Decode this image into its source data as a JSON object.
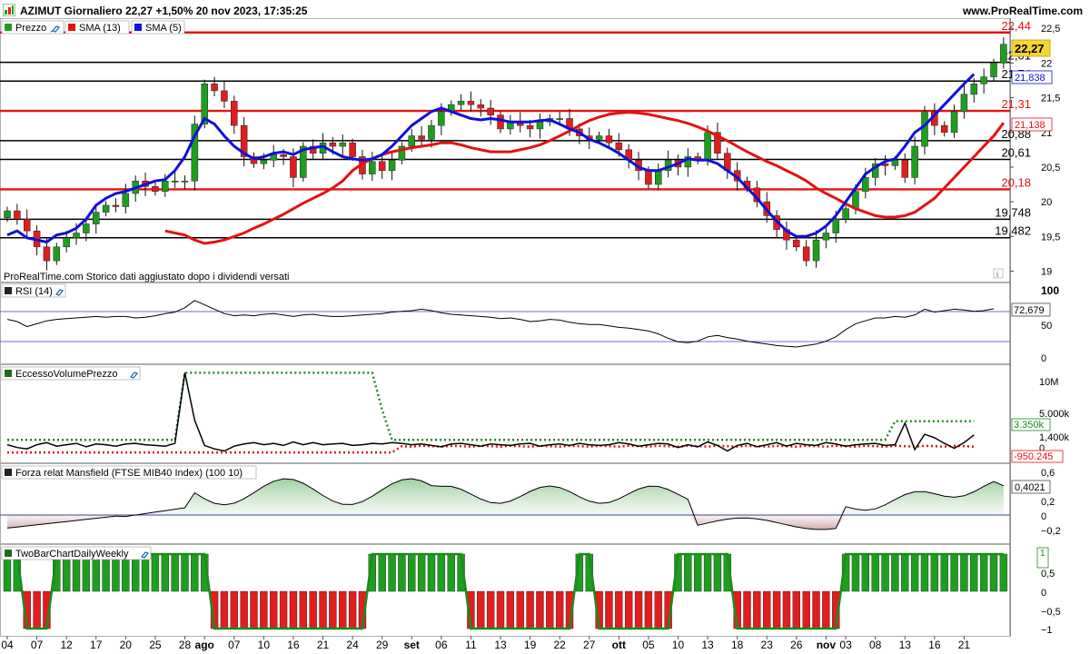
{
  "header": {
    "title": "AZIMUT Giornaliero 22,27 +1,50% 20 nov 2023, 17:35:25",
    "site": "www.ProRealTime.com"
  },
  "colors": {
    "up": "#1e9e1e",
    "down": "#e21d1d",
    "sma13": "#e31212",
    "sma5": "#1010d6",
    "dotted_green": "#1e8a1e",
    "dotted_red": "#e31212"
  },
  "price_panel": {
    "legend": [
      {
        "label": "Prezzo",
        "color": "#1e9e1e"
      },
      {
        "label": "SMA (13)",
        "color": "#e31212"
      },
      {
        "label": "SMA (5)",
        "color": "#1010d6"
      }
    ],
    "note": "ProRealTime.com Storico dati aggiustato dopo i dividendi versati",
    "y_ticks": [
      "22,5",
      "22",
      "21,5",
      "21",
      "20,5",
      "20",
      "19,5",
      "19"
    ],
    "last_price": "22,27",
    "sma5_value": "21,838",
    "sma13_value": "21,138",
    "levels": [
      {
        "value": 22.44,
        "label": "22,44",
        "color": "red"
      },
      {
        "value": 22.01,
        "label": "22,01",
        "color": "black"
      },
      {
        "value": 21.74,
        "label": "21,74",
        "color": "black"
      },
      {
        "value": 21.31,
        "label": "21,31",
        "color": "red"
      },
      {
        "value": 20.88,
        "label": "20,88",
        "color": "black"
      },
      {
        "value": 20.61,
        "label": "20,61",
        "color": "black"
      },
      {
        "value": 20.18,
        "label": "20,18",
        "color": "red"
      },
      {
        "value": 19.748,
        "label": "19,748",
        "color": "black"
      },
      {
        "value": 19.482,
        "label": "19,482",
        "color": "black"
      }
    ]
  },
  "rsi_panel": {
    "title": "RSI (14)",
    "y_ticks": [
      "100",
      "50",
      "0"
    ],
    "value": "72,679"
  },
  "volume_panel": {
    "title": "EccessoVolumePrezzo",
    "y_ticks": [
      "10M",
      "5.000k",
      "1,400k",
      "0"
    ],
    "value_green": "3.350k",
    "value_red": "-950.245"
  },
  "mansfield_panel": {
    "title": "Forza relat Mansfield (FTSE MIB40 Index) (100 10)",
    "y_ticks": [
      "0,6",
      "0,4021",
      "0,2",
      "0",
      "−0,2"
    ],
    "value": "0,4021"
  },
  "twobar_panel": {
    "title": "TwoBarChartDailyWeekly",
    "y_ticks": [
      "1",
      "0,5",
      "0",
      "−0,5",
      "−1"
    ],
    "value": "1"
  },
  "x_axis": {
    "labels": [
      {
        "text": "04",
        "idx": 0,
        "bold": false
      },
      {
        "text": "07",
        "idx": 3,
        "bold": false
      },
      {
        "text": "12",
        "idx": 6,
        "bold": false
      },
      {
        "text": "17",
        "idx": 9,
        "bold": false
      },
      {
        "text": "20",
        "idx": 12,
        "bold": false
      },
      {
        "text": "25",
        "idx": 15,
        "bold": false
      },
      {
        "text": "28",
        "idx": 18,
        "bold": false
      },
      {
        "text": "ago",
        "idx": 20,
        "bold": true
      },
      {
        "text": "07",
        "idx": 23,
        "bold": false
      },
      {
        "text": "10",
        "idx": 26,
        "bold": false
      },
      {
        "text": "16",
        "idx": 29,
        "bold": false
      },
      {
        "text": "21",
        "idx": 32,
        "bold": false
      },
      {
        "text": "24",
        "idx": 35,
        "bold": false
      },
      {
        "text": "29",
        "idx": 38,
        "bold": false
      },
      {
        "text": "set",
        "idx": 41,
        "bold": true
      },
      {
        "text": "06",
        "idx": 44,
        "bold": false
      },
      {
        "text": "11",
        "idx": 47,
        "bold": false
      },
      {
        "text": "13",
        "idx": 50,
        "bold": false
      },
      {
        "text": "19",
        "idx": 53,
        "bold": false
      },
      {
        "text": "22",
        "idx": 56,
        "bold": false
      },
      {
        "text": "27",
        "idx": 59,
        "bold": false
      },
      {
        "text": "ott",
        "idx": 62,
        "bold": true
      },
      {
        "text": "05",
        "idx": 65,
        "bold": false
      },
      {
        "text": "10",
        "idx": 68,
        "bold": false
      },
      {
        "text": "13",
        "idx": 71,
        "bold": false
      },
      {
        "text": "18",
        "idx": 74,
        "bold": false
      },
      {
        "text": "23",
        "idx": 77,
        "bold": false
      },
      {
        "text": "26",
        "idx": 80,
        "bold": false
      },
      {
        "text": "nov",
        "idx": 83,
        "bold": true
      },
      {
        "text": "03",
        "idx": 85,
        "bold": false
      },
      {
        "text": "08",
        "idx": 88,
        "bold": false
      },
      {
        "text": "13",
        "idx": 91,
        "bold": false
      },
      {
        "text": "16",
        "idx": 94,
        "bold": false
      },
      {
        "text": "21",
        "idx": 97,
        "bold": false
      }
    ]
  },
  "chart_data": [
    {
      "type": "candlestick",
      "ylim": [
        18.85,
        22.62
      ],
      "close": [
        19.87,
        19.75,
        19.58,
        19.35,
        19.15,
        19.35,
        19.48,
        19.55,
        19.68,
        19.85,
        19.95,
        19.93,
        20.12,
        20.3,
        20.22,
        20.15,
        20.3,
        20.3,
        20.3,
        21.12,
        21.7,
        21.6,
        21.45,
        21.1,
        20.65,
        20.55,
        20.6,
        20.68,
        20.65,
        20.35,
        20.8,
        20.7,
        20.85,
        20.8,
        20.85,
        20.65,
        20.4,
        20.58,
        20.45,
        20.6,
        20.8,
        20.95,
        20.9,
        21.1,
        21.3,
        21.4,
        21.45,
        21.4,
        21.35,
        21.25,
        21.05,
        21.15,
        21.1,
        21.05,
        21.15,
        21.2,
        21.2,
        21.05,
        20.95,
        20.9,
        20.95,
        20.85,
        20.75,
        20.6,
        20.45,
        20.25,
        20.45,
        20.6,
        20.5,
        20.65,
        20.6,
        21.0,
        20.7,
        20.45,
        20.3,
        20.2,
        20.0,
        19.8,
        19.6,
        19.45,
        19.35,
        19.15,
        19.45,
        19.55,
        19.75,
        19.9,
        20.15,
        20.35,
        20.55,
        20.52,
        20.6,
        20.35,
        20.8,
        21.3,
        21.1,
        21.0,
        21.3,
        21.55,
        21.7,
        21.8,
        22.0,
        22.27
      ],
      "sma5": [
        19.52,
        19.58,
        19.48,
        19.45,
        19.42,
        19.52,
        19.55,
        19.62,
        19.75,
        19.95,
        20.05,
        20.12,
        20.15,
        20.2,
        20.25,
        20.3,
        20.32,
        20.45,
        20.65,
        20.95,
        21.2,
        21.12,
        20.95,
        20.8,
        20.7,
        20.62,
        20.65,
        20.7,
        20.72,
        20.68,
        20.75,
        20.78,
        20.8,
        20.72,
        20.65,
        20.62,
        20.6,
        20.62,
        20.68,
        20.8,
        20.95,
        21.1,
        21.2,
        21.3,
        21.35,
        21.3,
        21.25,
        21.2,
        21.18,
        21.2,
        21.18,
        21.15,
        21.15,
        21.15,
        21.17,
        21.18,
        21.12,
        21.05,
        21.0,
        20.9,
        20.85,
        20.78,
        20.7,
        20.6,
        20.5,
        20.45,
        20.45,
        20.5,
        20.55,
        20.62,
        20.6,
        20.6,
        20.55,
        20.45,
        20.35,
        20.2,
        20.05,
        19.88,
        19.72,
        19.58,
        19.5,
        19.5,
        19.55,
        19.65,
        19.8,
        20.0,
        20.2,
        20.4,
        20.5,
        20.58,
        20.62,
        20.8,
        21.0,
        21.1,
        21.25,
        21.4,
        21.55,
        21.7,
        21.838
      ],
      "sma13": [
        19.58,
        19.55,
        19.52,
        19.45,
        19.4,
        19.42,
        19.45,
        19.5,
        19.55,
        19.62,
        19.68,
        19.75,
        19.82,
        19.9,
        19.98,
        20.05,
        20.12,
        20.2,
        20.3,
        20.45,
        20.55,
        20.62,
        20.68,
        20.72,
        20.75,
        20.78,
        20.8,
        20.82,
        20.85,
        20.85,
        20.82,
        20.78,
        20.75,
        20.72,
        20.72,
        20.72,
        20.75,
        20.78,
        20.82,
        20.88,
        20.95,
        21.02,
        21.1,
        21.17,
        21.22,
        21.26,
        21.28,
        21.29,
        21.28,
        21.26,
        21.23,
        21.2,
        21.17,
        21.13,
        21.08,
        21.02,
        20.95,
        20.88,
        20.8,
        20.72,
        20.65,
        20.58,
        20.52,
        20.45,
        20.38,
        20.3,
        20.2,
        20.12,
        20.05,
        19.97,
        19.9,
        19.85,
        19.8,
        19.78,
        19.78,
        19.8,
        19.85,
        19.95,
        20.05,
        20.2,
        20.35,
        20.5,
        20.65,
        20.8,
        20.95,
        21.138
      ]
    },
    {
      "type": "line",
      "name": "RSI (14)",
      "ylim": [
        0,
        100
      ],
      "values": [
        58,
        55,
        48,
        52,
        56,
        58,
        59,
        60,
        61,
        62,
        61,
        62,
        62,
        60,
        61,
        63,
        66,
        68,
        74,
        84,
        78,
        72,
        66,
        63,
        64,
        63,
        65,
        66,
        64,
        62,
        64,
        65,
        63,
        62,
        62,
        63,
        64,
        65,
        66,
        68,
        69,
        70,
        72,
        70,
        67,
        65,
        64,
        63,
        62,
        61,
        59,
        60,
        58,
        55,
        56,
        58,
        57,
        54,
        52,
        51,
        51,
        49,
        47,
        46,
        44,
        42,
        38,
        32,
        27,
        26,
        28,
        34,
        36,
        33,
        31,
        28,
        26,
        24,
        22,
        21,
        20,
        22,
        24,
        28,
        34,
        44,
        52,
        56,
        60,
        60,
        62,
        61,
        64,
        72,
        68,
        70,
        72,
        71,
        69,
        70,
        72.679
      ]
    },
    {
      "type": "line",
      "name": "EccessoVolumePrezzo",
      "ylim": [
        -2000,
        11000
      ],
      "values": [
        0,
        -400,
        -600,
        0,
        300,
        -200,
        0,
        200,
        -300,
        100,
        0,
        -200,
        100,
        200,
        0,
        -100,
        -200,
        200,
        10300,
        3500,
        -100,
        -600,
        -900,
        -200,
        100,
        300,
        0,
        200,
        -100,
        400,
        0,
        300,
        0,
        100,
        200,
        -100,
        0,
        200,
        100,
        300,
        200,
        0,
        100,
        -100,
        -300,
        100,
        200,
        0,
        -200,
        100,
        0,
        -100,
        100,
        200,
        -200,
        0,
        100,
        -100,
        200,
        0,
        -100,
        0,
        300,
        100,
        -200,
        0,
        200,
        100,
        -400,
        0,
        -300,
        400,
        -100,
        -900,
        -100,
        200,
        -300,
        0,
        300,
        -200,
        200,
        0,
        -100,
        300,
        100,
        -200,
        0,
        100,
        200,
        -100,
        0,
        3100,
        -700,
        1500,
        1000,
        200,
        -500,
        300,
        1400
      ]
    }
  ]
}
